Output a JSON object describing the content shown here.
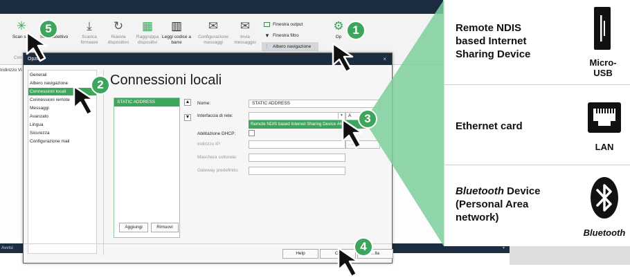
{
  "ribbon": {
    "scan_label": "Scan sist",
    "scan_sel_label": "Scan selettivo",
    "buttons": [
      {
        "label": "Scarica firmware"
      },
      {
        "label": "Riavvia dispositivo"
      },
      {
        "label": "Raggruppa dispositivi"
      },
      {
        "label": "Leggi codice a barre"
      },
      {
        "label": "Configurazione messaggi"
      },
      {
        "label": "Invia messaggio"
      }
    ],
    "toggles": [
      "Finestra output",
      "Finestra filtro",
      "Albero navigazione"
    ],
    "options_label": "Op",
    "group_label": "Con"
  },
  "app": {
    "address_label": "Indirizzo Vi",
    "bottom_label": "Avvisi",
    "bottom_right": "▾"
  },
  "dialog": {
    "title": "Opzioni",
    "close": "×",
    "nav": [
      "Generali",
      "Albero navigazione",
      "Connessioni locali",
      "Connessioni remote",
      "Messaggi",
      "Avanzato",
      "Lingua",
      "Sicurezza",
      "Configurazione mail"
    ],
    "heading": "Connessioni locali",
    "connections": [
      "STATIC ADDRESS"
    ],
    "add_button": "Aggiungi",
    "remove_button": "Rimuovi",
    "fields": {
      "name_label": "Nome:",
      "name_value": "STATIC ADDRESS",
      "iface_label": "Interfaccia di rete:",
      "dhcp_label": "Abilitazione DHCP:",
      "ip_label": "Indirizzo IP:",
      "mask_label": "Maschera sottorete:",
      "gateway_label": "Gateway predefinito:"
    },
    "dropdown_option": "Remote NDIS based Internet Sharing Device #4",
    "side_btn_top": "A",
    "side_btn_ip": "...a IP",
    "help_button": "Help",
    "ok_button": "Ok",
    "cancel_button": "...lla"
  },
  "callouts": [
    "1",
    "2",
    "3",
    "4",
    "5"
  ],
  "panel": {
    "rows": [
      {
        "text": [
          "Remote NDIS",
          "based Internet",
          "Sharing Device"
        ],
        "caption": [
          "Micro-",
          "USB"
        ],
        "icon": "micro-usb-icon"
      },
      {
        "text": [
          "Ethernet card"
        ],
        "caption": [
          "LAN"
        ],
        "icon": "lan-port-icon"
      },
      {
        "text_italic": "Bluetooth",
        "text_rest": " Device",
        "text_more": [
          "(Personal Area",
          "network)"
        ],
        "caption": [
          "Bluetooth"
        ],
        "icon": "bluetooth-icon"
      }
    ]
  },
  "colors": {
    "accent": "#3da65c",
    "dark": "#1c2d3f",
    "highlight": "#7ccf9b"
  }
}
